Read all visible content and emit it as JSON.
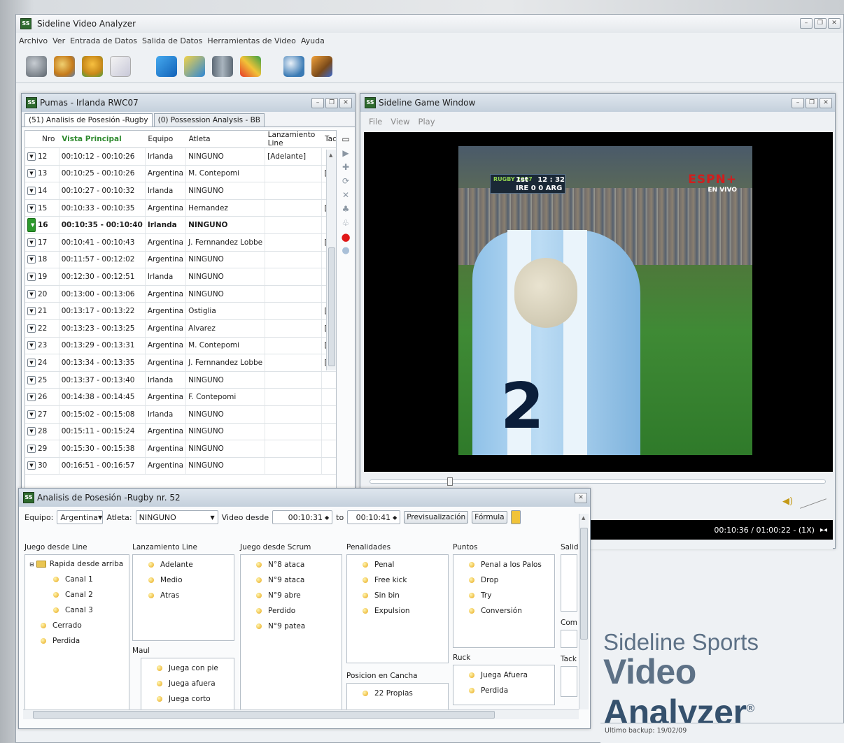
{
  "app": {
    "title": "Sideline Video Analyzer",
    "menu": [
      "Archivo",
      "Ver",
      "Entrada de Datos",
      "Salida de Datos",
      "Herramientas de Video",
      "Ayuda"
    ]
  },
  "toolbar": {
    "icons": [
      "server-icon",
      "users-icon",
      "puzzle-icon",
      "checklist-icon",
      "copy-icon",
      "copy-blue-icon",
      "cylinder-icon",
      "chart-icon",
      "magnifier-icon",
      "report-icon"
    ]
  },
  "left": {
    "title": "Pumas - Irlanda RWC07",
    "tabs": [
      "(51) Analisis de Posesión -Rugby",
      "(0) Possession Analysis - BB"
    ],
    "headers": [
      "Nro",
      "Vista Principal",
      "Equipo",
      "Atleta",
      "Lanzamiento Line",
      "Tack"
    ],
    "rows": [
      [
        "12",
        "00:10:12 - 00:10:26",
        "Irlanda",
        "NINGUNO",
        "[Adelante]",
        ""
      ],
      [
        "13",
        "00:10:25 - 00:10:26",
        "Argentina",
        "M. Contepomi",
        "",
        "[Acer"
      ],
      [
        "14",
        "00:10:27 - 00:10:32",
        "Irlanda",
        "NINGUNO",
        "",
        ""
      ],
      [
        "15",
        "00:10:33 - 00:10:35",
        "Argentina",
        "Hernandez",
        "",
        "[Acer"
      ],
      [
        "16",
        "00:10:35 - 00:10:40",
        "Irlanda",
        "NINGUNO",
        "",
        ""
      ],
      [
        "17",
        "00:10:41 - 00:10:43",
        "Argentina",
        "J. Fernnandez Lobbe",
        "",
        "[Acer"
      ],
      [
        "18",
        "00:11:57 - 00:12:02",
        "Argentina",
        "NINGUNO",
        "",
        ""
      ],
      [
        "19",
        "00:12:30 - 00:12:51",
        "Irlanda",
        "NINGUNO",
        "",
        ""
      ],
      [
        "20",
        "00:13:00 - 00:13:06",
        "Argentina",
        "NINGUNO",
        "",
        ""
      ],
      [
        "21",
        "00:13:17 - 00:13:22",
        "Argentina",
        "Ostiglia",
        "",
        "[Acer"
      ],
      [
        "22",
        "00:13:23 - 00:13:25",
        "Argentina",
        "Alvarez",
        "",
        "[Acer"
      ],
      [
        "23",
        "00:13:29 - 00:13:31",
        "Argentina",
        "M. Contepomi",
        "",
        "[Acer"
      ],
      [
        "24",
        "00:13:34 - 00:13:35",
        "Argentina",
        "J. Fernnandez Lobbe",
        "",
        "[Acer"
      ],
      [
        "25",
        "00:13:37 - 00:13:40",
        "Irlanda",
        "NINGUNO",
        "",
        ""
      ],
      [
        "26",
        "00:14:38 - 00:14:45",
        "Argentina",
        "F. Contepomi",
        "",
        ""
      ],
      [
        "27",
        "00:15:02 - 00:15:08",
        "Irlanda",
        "NINGUNO",
        "",
        ""
      ],
      [
        "28",
        "00:15:11 - 00:15:24",
        "Argentina",
        "NINGUNO",
        "",
        ""
      ],
      [
        "29",
        "00:15:30 - 00:15:38",
        "Argentina",
        "NINGUNO",
        "",
        ""
      ],
      [
        "30",
        "00:16:51 - 00:16:57",
        "Argentina",
        "NINGUNO",
        "",
        ""
      ]
    ]
  },
  "game": {
    "title": "Sideline Game Window",
    "menu": [
      "File",
      "View",
      "Play"
    ],
    "time": "00:10:36 / 01:00:22 - (1X)",
    "score": {
      "event": "RUGBY 2007",
      "half": "1st",
      "clock": "12 : 32",
      "home": "IRE",
      "home_score": "0",
      "away": "ARG",
      "away_score": "0"
    },
    "broadcaster": "ESPN+",
    "live": "EN VIVO",
    "jersey": "2"
  },
  "dialog": {
    "title": "Analisis de Posesión -Rugby nr. 52",
    "equipo_label": "Equipo:",
    "equipo": "Argentina",
    "atleta_label": "Atleta:",
    "atleta": "NINGUNO",
    "video_label": "Video desde",
    "from": "00:10:31",
    "to_label": "to",
    "to": "00:10:41",
    "preview": "Previsualización",
    "formula": "Fórmula",
    "groups": {
      "juego_line": {
        "label": "Juego desde Line",
        "folder": "Rapida desde arriba",
        "sub": [
          "Canal 1",
          "Canal 2",
          "Canal 3"
        ],
        "items": [
          "Cerrado",
          "Perdida"
        ]
      },
      "lanz": {
        "label": "Lanzamiento Line",
        "items": [
          "Adelante",
          "Medio",
          "Atras"
        ]
      },
      "maul": {
        "label": "Maul",
        "items": [
          "Juega con pie",
          "Juega afuera",
          "Juega corto"
        ]
      },
      "scrum": {
        "label": "Juego desde Scrum",
        "items": [
          "N°8 ataca",
          "N°9 ataca",
          "N°9 abre",
          "Perdido",
          "N°9 patea"
        ]
      },
      "penal": {
        "label": "Penalidades",
        "items": [
          "Penal",
          "Free kick",
          "Sin bin",
          "Expulsion"
        ]
      },
      "posicion": {
        "label": "Posicion en Cancha",
        "items": [
          "22 Propias"
        ]
      },
      "puntos": {
        "label": "Puntos",
        "items": [
          "Penal a los Palos",
          "Drop",
          "Try",
          "Conversión"
        ]
      },
      "ruck": {
        "label": "Ruck",
        "items": [
          "Juega Afuera",
          "Perdida"
        ]
      },
      "salida": {
        "label": "Salid"
      },
      "com": {
        "label": "Com"
      },
      "tack": {
        "label": "Tack"
      }
    }
  },
  "brand": {
    "line1": "Sideline Sports",
    "line2a": "Video ",
    "line2b": "Analyzer",
    "reg": "®"
  },
  "status": {
    "backup": "Ultimo backup: 19/02/09"
  }
}
